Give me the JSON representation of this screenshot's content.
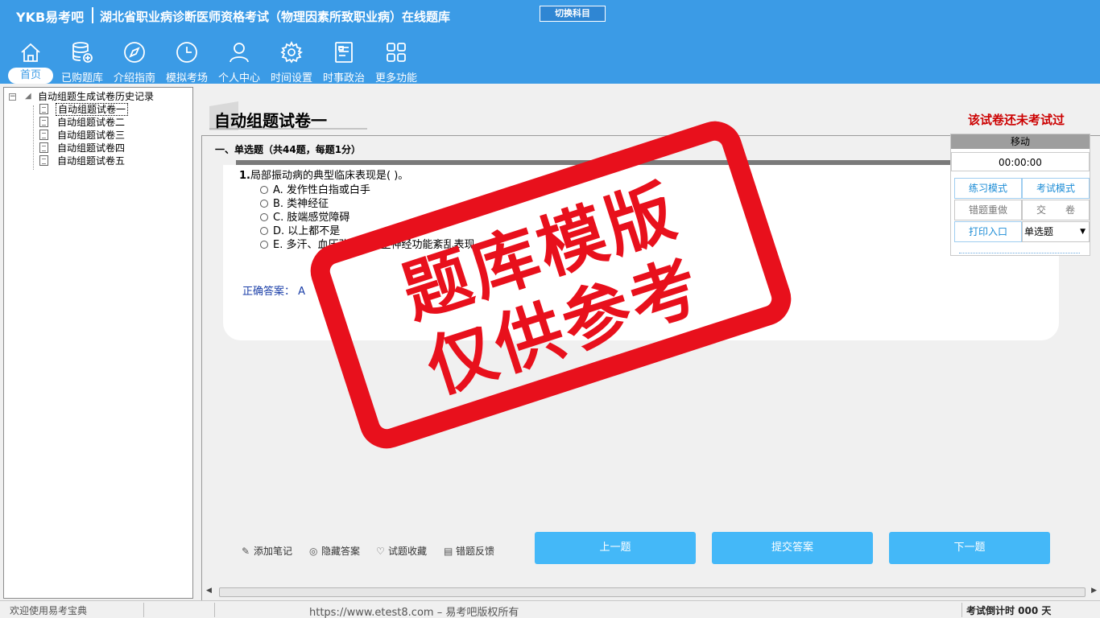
{
  "header": {
    "brand": "YKB易考吧",
    "title": "湖北省职业病诊断医师资格考试（物理因素所致职业病）在线题库",
    "switch_button": "切换科目",
    "nav": [
      {
        "label": "首页",
        "icon": "home-icon"
      },
      {
        "label": "已购题库",
        "icon": "database-icon"
      },
      {
        "label": "介绍指南",
        "icon": "compass-icon"
      },
      {
        "label": "模拟考场",
        "icon": "clock-icon"
      },
      {
        "label": "个人中心",
        "icon": "user-icon"
      },
      {
        "label": "时间设置",
        "icon": "gear-icon"
      },
      {
        "label": "时事政治",
        "icon": "news-icon"
      },
      {
        "label": "更多功能",
        "icon": "grid-icon"
      }
    ]
  },
  "tree": {
    "root": "自动组题生成试卷历史记录",
    "items": [
      "自动组题试卷一",
      "自动组题试卷二",
      "自动组题试卷三",
      "自动组题试卷四",
      "自动组题试卷五"
    ]
  },
  "main": {
    "paper_title": "自动组题试卷一",
    "status": "该试卷还未考试过",
    "section_title": "一、单选题（共44题，每题1分）",
    "question": {
      "number": "1.",
      "stem": "局部振动病的典型临床表现是( )。",
      "options": [
        "A. 发作性白指或白手",
        "B. 类神经征",
        "C. 肢端感觉障碍",
        "D. 以上都不是",
        "E. 多汗、血压改变等自主神经功能紊乱表现"
      ],
      "answer_label": "正确答案：",
      "answer_value": "A"
    },
    "tools": [
      "添加笔记",
      "隐藏答案",
      "试题收藏",
      "错题反馈"
    ],
    "buttons": {
      "prev": "上一题",
      "submit": "提交答案",
      "next": "下一题"
    }
  },
  "control_panel": {
    "header": "移动",
    "timer": "00:00:00",
    "practice_mode": "练习模式",
    "exam_mode": "考试模式",
    "redo_wrong": "错题重做",
    "hand_in": "交　　卷",
    "print": "打印入口",
    "question_type": "单选题"
  },
  "stamp": {
    "line1": "题库模版",
    "line2": "仅供参考"
  },
  "statusbar": {
    "welcome": "欢迎使用易考宝典",
    "url": "https://www.etest8.com – 易考吧版权所有",
    "countdown": "考试倒计时 000 天"
  },
  "colors": {
    "header": "#3b9be6",
    "accent_button": "#44b8f8",
    "stamp": "#e8101c",
    "status_red": "#cc0000"
  }
}
